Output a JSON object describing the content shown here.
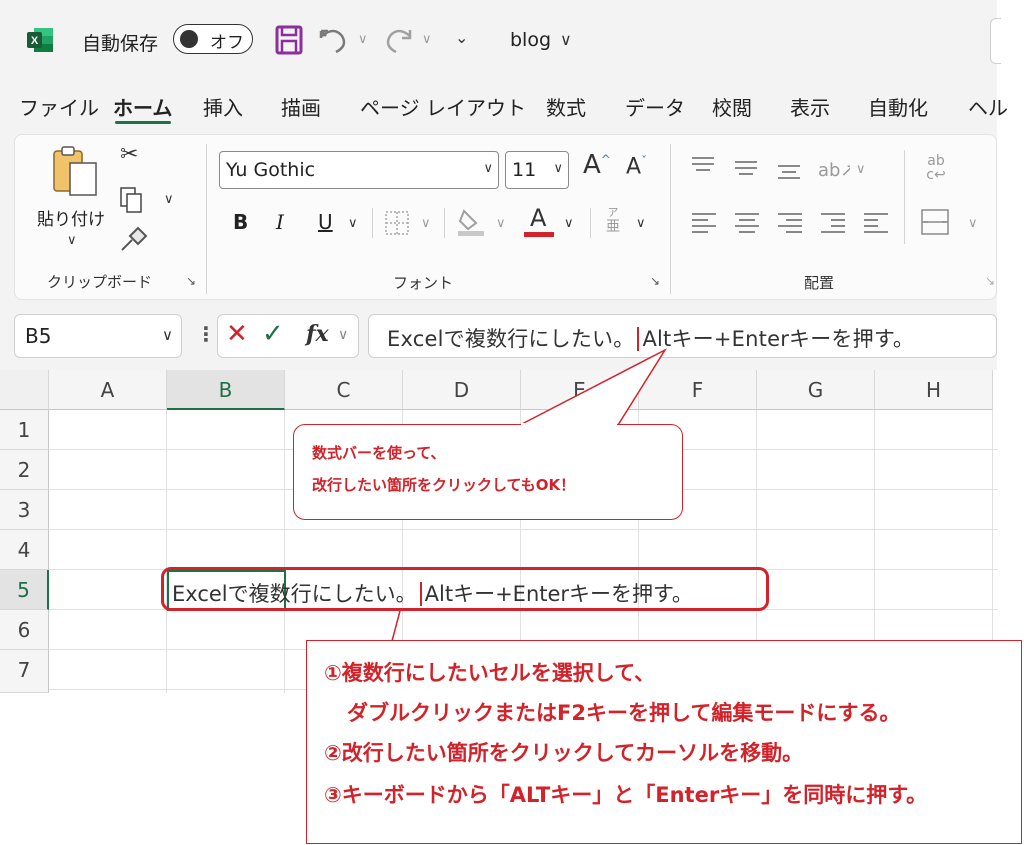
{
  "titlebar": {
    "autosave_label": "自動保存",
    "toggle_label": "オフ",
    "filename": "blog",
    "filename_caret": "∨"
  },
  "tabs": [
    "ファイル",
    "ホーム",
    "挿入",
    "描画",
    "ページ レイアウト",
    "数式",
    "データ",
    "校閲",
    "表示",
    "自動化",
    "ヘル"
  ],
  "ribbon": {
    "paste_label": "貼り付け",
    "clipboard_label": "クリップボード",
    "font_name": "Yu Gothic",
    "font_size": "11",
    "font_group_label": "フォント",
    "align_group_label": "配置",
    "bold": "B",
    "italic": "I",
    "underline": "U",
    "font_color_glyph": "A",
    "grow_font": "A",
    "shrink_font": "A",
    "phonetic_top": "ア",
    "phonetic_bottom": "亜",
    "wrap_glyph_top": "ab",
    "wrap_glyph_bottom": "c↩"
  },
  "formula_bar": {
    "name_box": "B5",
    "fx_label": "fx",
    "formula_before": "Excelで複数行にしたい。",
    "formula_after": "Altキー+Enterキーを押す。"
  },
  "grid": {
    "columns": [
      "A",
      "B",
      "C",
      "D",
      "E",
      "F",
      "G",
      "H"
    ],
    "rows": [
      "1",
      "2",
      "3",
      "4",
      "5",
      "6",
      "7"
    ],
    "cell_b5_before": "Excelで複数行にしたい。",
    "cell_b5_after": "Altキー+Enterキーを押す。"
  },
  "annotations": {
    "bubble_line1": "数式バーを使って、",
    "bubble_line2": "改行したい箇所をクリックしてもOK！",
    "step1a": "①複数行にしたいセルを選択して、",
    "step1b": "ダブルクリックまたはF2キーを押して編集モードにする。",
    "step2": "②改行したい箇所をクリックしてカーソルを移動。",
    "step3": "③キーボードから「ALTキー」と「Enterキー」を同時に押す。"
  },
  "colors": {
    "accent_green": "#1e7145",
    "annotation_red": "#d2232a"
  }
}
